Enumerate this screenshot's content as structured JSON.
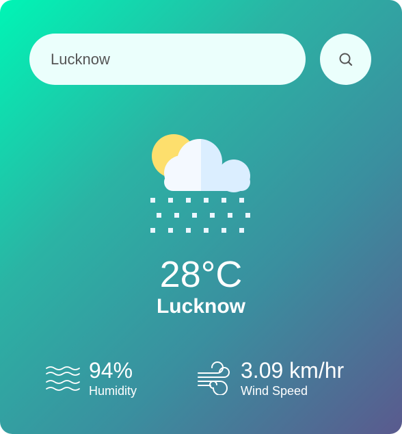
{
  "search": {
    "value": "Lucknow"
  },
  "icons": {
    "search": "search-icon",
    "weather": "sun-cloud-snow-icon",
    "humidity": "waves-icon",
    "wind": "wind-icon"
  },
  "weather": {
    "temperature": "28°C",
    "city": "Lucknow"
  },
  "details": {
    "humidity": {
      "value": "94%",
      "label": "Humidity"
    },
    "wind": {
      "value": "3.09 km/hr",
      "label": "Wind Speed"
    }
  },
  "colors": {
    "gradient_start": "#00f5b5",
    "gradient_end": "#5a5a8e",
    "input_bg": "#ebfffc",
    "text": "#ffffff"
  }
}
